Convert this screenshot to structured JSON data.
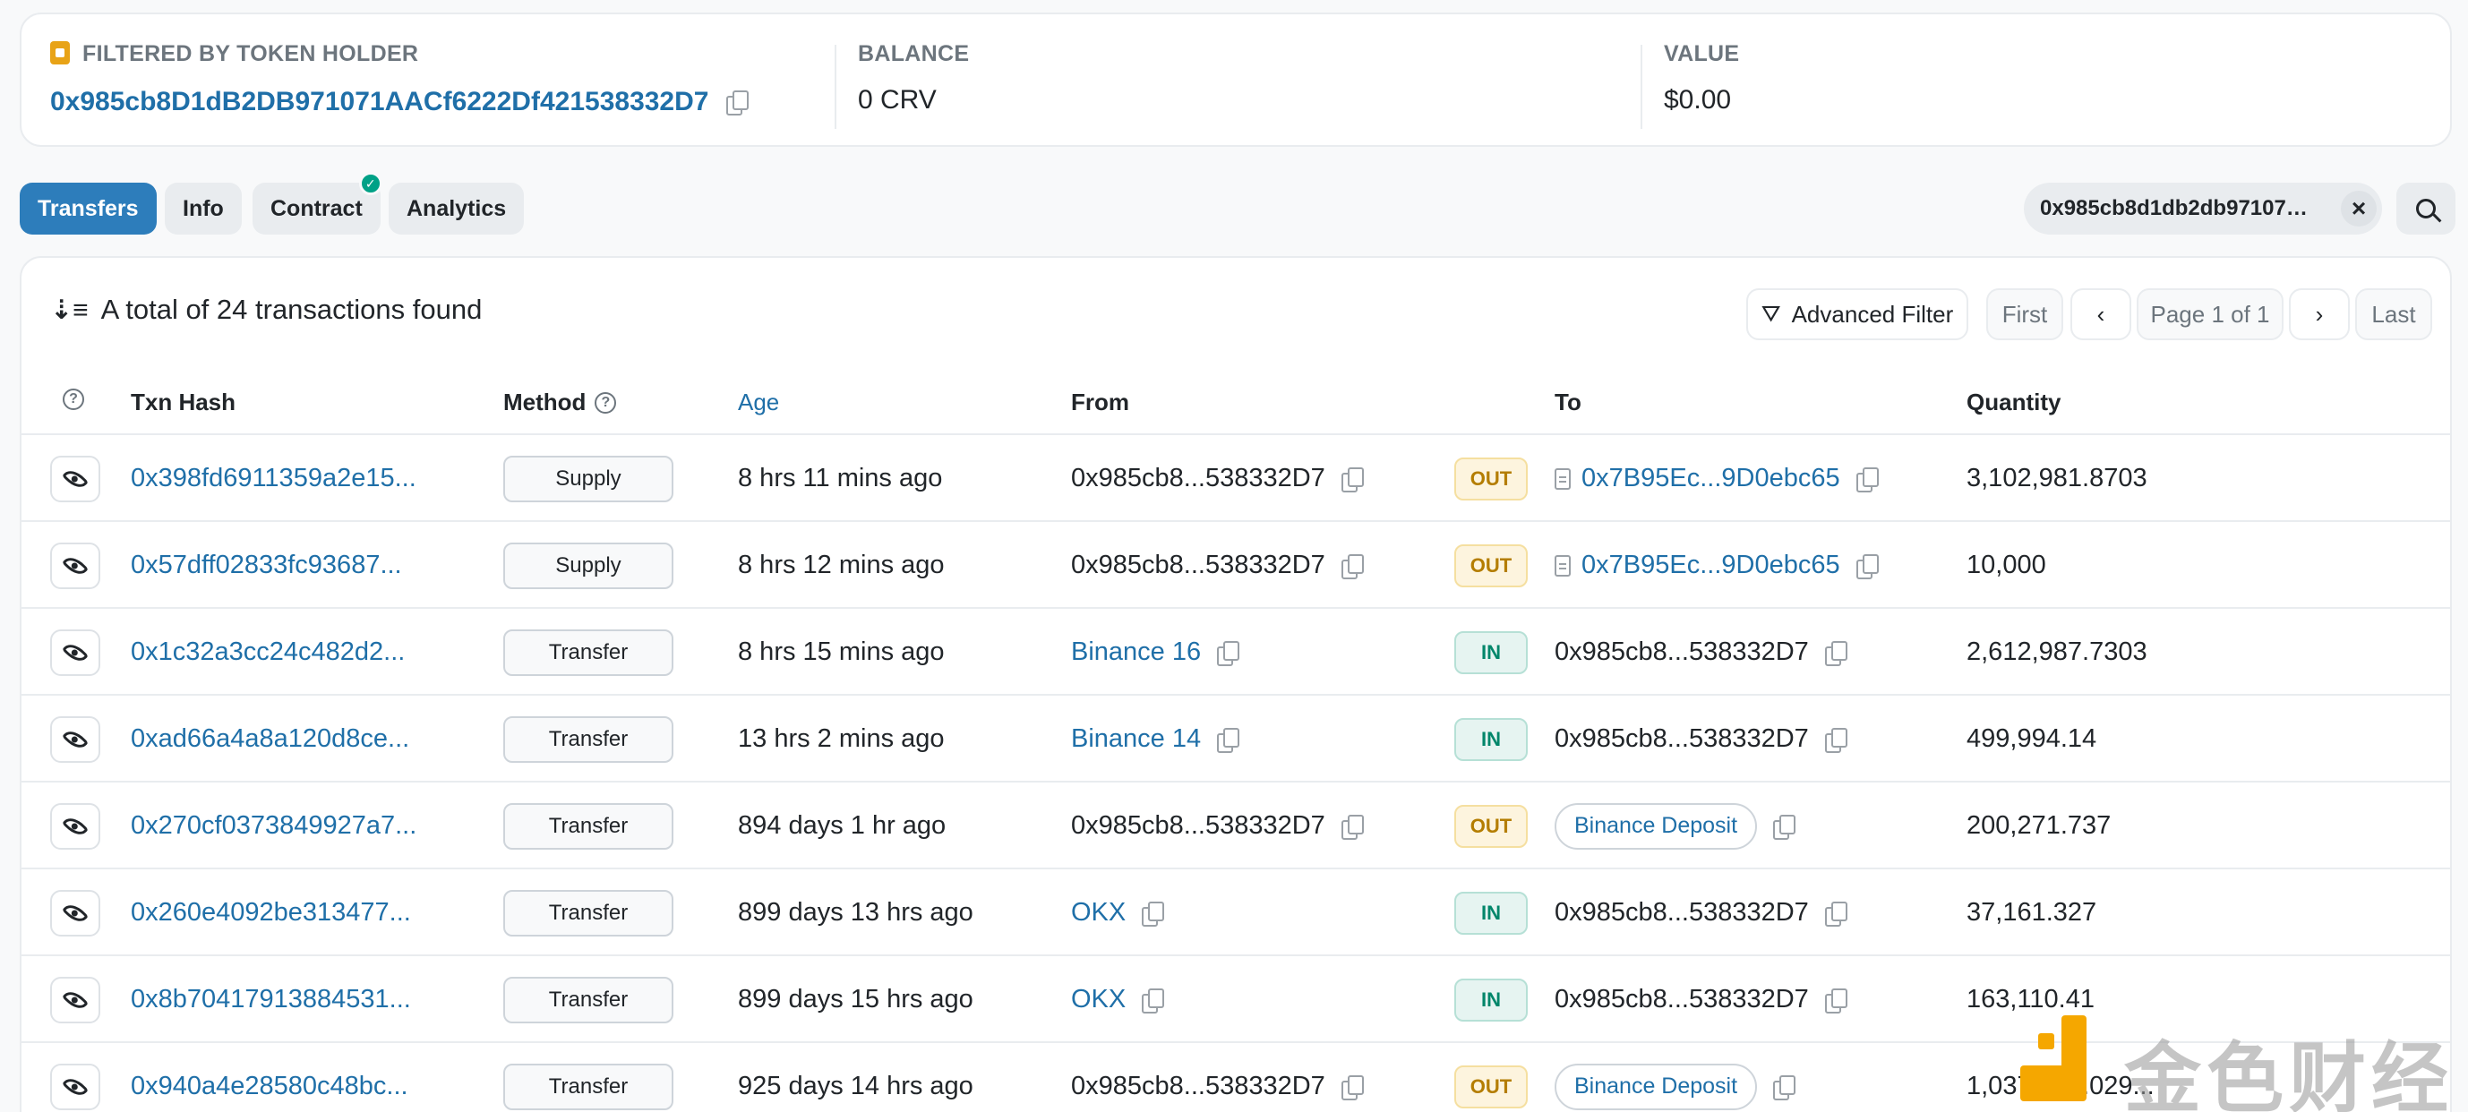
{
  "summary": {
    "holder_label": "FILTERED BY TOKEN HOLDER",
    "holder_address": "0x985cb8D1dB2DB971071AACf6222Df421538332D7",
    "balance_label": "BALANCE",
    "balance_value": "0 CRV",
    "value_label": "VALUE",
    "value_value": "$0.00"
  },
  "tabs": [
    {
      "label": "Transfers",
      "active": true
    },
    {
      "label": "Info"
    },
    {
      "label": "Contract",
      "verified": true
    },
    {
      "label": "Analytics"
    }
  ],
  "filter_chip": "0x985cb8d1db2db971071a...",
  "toolbar": {
    "total_text": "A total of 24 transactions found",
    "advanced_filter": "Advanced Filter",
    "first": "First",
    "page": "Page 1 of 1",
    "last": "Last"
  },
  "columns": {
    "txn_hash": "Txn Hash",
    "method": "Method",
    "age": "Age",
    "from": "From",
    "to": "To",
    "quantity": "Quantity"
  },
  "rows": [
    {
      "hash": "0x398fd6911359a2e15...",
      "method": "Supply",
      "age": "8 hrs 11 mins ago",
      "from": "0x985cb8...538332D7",
      "from_link": false,
      "dir": "OUT",
      "to": "0x7B95Ec...9D0ebc65",
      "to_type": "contract",
      "qty": "3,102,981.8703"
    },
    {
      "hash": "0x57dff02833fc93687...",
      "method": "Supply",
      "age": "8 hrs 12 mins ago",
      "from": "0x985cb8...538332D7",
      "from_link": false,
      "dir": "OUT",
      "to": "0x7B95Ec...9D0ebc65",
      "to_type": "contract",
      "qty": "10,000"
    },
    {
      "hash": "0x1c32a3cc24c482d2...",
      "method": "Transfer",
      "age": "8 hrs 15 mins ago",
      "from": "Binance 16",
      "from_link": true,
      "dir": "IN",
      "to": "0x985cb8...538332D7",
      "to_type": "plain",
      "qty": "2,612,987.7303"
    },
    {
      "hash": "0xad66a4a8a120d8ce...",
      "method": "Transfer",
      "age": "13 hrs 2 mins ago",
      "from": "Binance 14",
      "from_link": true,
      "dir": "IN",
      "to": "0x985cb8...538332D7",
      "to_type": "plain",
      "qty": "499,994.14"
    },
    {
      "hash": "0x270cf0373849927a7...",
      "method": "Transfer",
      "age": "894 days 1 hr ago",
      "from": "0x985cb8...538332D7",
      "from_link": false,
      "dir": "OUT",
      "to": "Binance Deposit",
      "to_type": "pill",
      "qty": "200,271.737"
    },
    {
      "hash": "0x260e4092be313477...",
      "method": "Transfer",
      "age": "899 days 13 hrs ago",
      "from": "OKX",
      "from_link": true,
      "dir": "IN",
      "to": "0x985cb8...538332D7",
      "to_type": "plain",
      "qty": "37,161.327"
    },
    {
      "hash": "0x8b70417913884531...",
      "method": "Transfer",
      "age": "899 days 15 hrs ago",
      "from": "OKX",
      "from_link": true,
      "dir": "IN",
      "to": "0x985cb8...538332D7",
      "to_type": "plain",
      "qty": "163,110.41"
    },
    {
      "hash": "0x940a4e28580c48bc...",
      "method": "Transfer",
      "age": "925 days 14 hrs ago",
      "from": "0x985cb8...538332D7",
      "from_link": false,
      "dir": "OUT",
      "to": "Binance Deposit",
      "to_type": "pill",
      "qty": "1,037,075.029..."
    }
  ],
  "watermark": {
    "text": "金色财经"
  },
  "colors": {
    "accent": "#2d7dbb",
    "link": "#1f6fa8",
    "out": "#b47d00",
    "in": "#00866a",
    "watermark_logo": "#f5a700"
  }
}
